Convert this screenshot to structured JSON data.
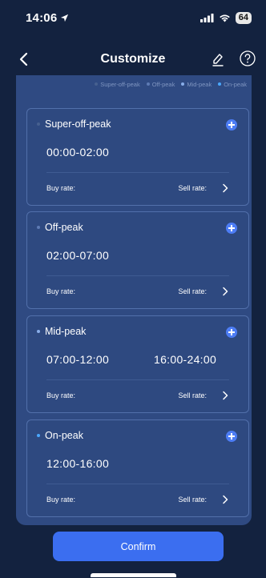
{
  "status_bar": {
    "time": "14:06",
    "battery": "64"
  },
  "nav": {
    "title": "Customize"
  },
  "legend": [
    {
      "label": "Super-off-peak",
      "color": "#46608f"
    },
    {
      "label": "Off-peak",
      "color": "#5e7bb4"
    },
    {
      "label": "Mid-peak",
      "color": "#89aee9"
    },
    {
      "label": "On-peak",
      "color": "#4aa8ff"
    }
  ],
  "cards": [
    {
      "title": "Super-off-peak",
      "dot_color": "#46608f",
      "range1": "00:00-02:00",
      "range2": "",
      "buy_label": "Buy rate:",
      "sell_label": "Sell rate:"
    },
    {
      "title": "Off-peak",
      "dot_color": "#5e7bb4",
      "range1": "02:00-07:00",
      "range2": "",
      "buy_label": "Buy rate:",
      "sell_label": "Sell rate:"
    },
    {
      "title": "Mid-peak",
      "dot_color": "#89aee9",
      "range1": "07:00-12:00",
      "range2": "16:00-24:00",
      "buy_label": "Buy rate:",
      "sell_label": "Sell rate:"
    },
    {
      "title": "On-peak",
      "dot_color": "#4aa8ff",
      "range1": "12:00-16:00",
      "range2": "",
      "buy_label": "Buy rate:",
      "sell_label": "Sell rate:"
    }
  ],
  "confirm_label": "Confirm",
  "colors": {
    "background": "#13223f",
    "panel": "#2f4a82",
    "accent": "#3b6ef0"
  }
}
